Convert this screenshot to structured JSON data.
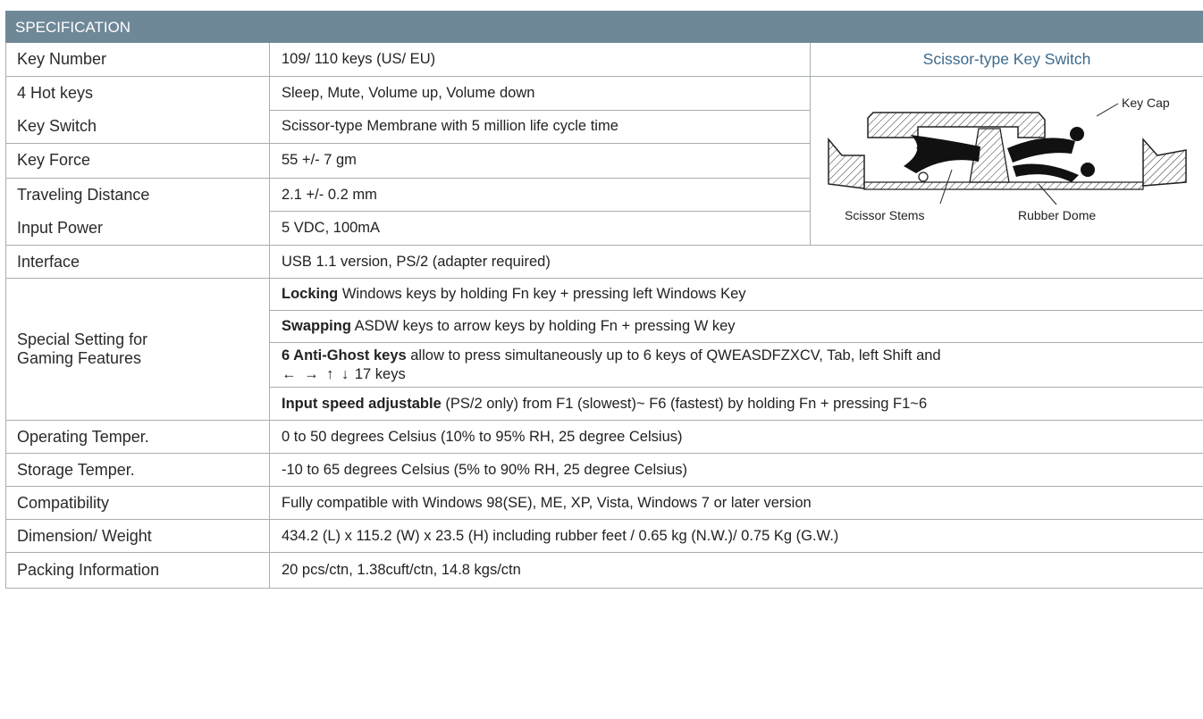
{
  "header": {
    "title": "SPECIFICATION"
  },
  "image": {
    "title": "Scissor-type Key Switch",
    "labels": {
      "key_cap": "Key Cap",
      "scissor_stems": "Scissor Stems",
      "rubber_dome": "Rubber Dome"
    }
  },
  "rows": {
    "key_number": {
      "label": "Key Number",
      "value": "109/ 110 keys (US/ EU)"
    },
    "hot_keys": {
      "label": "4 Hot keys",
      "value": "Sleep, Mute, Volume up, Volume down"
    },
    "key_switch": {
      "label": "Key Switch",
      "value": "Scissor-type Membrane with 5 million life cycle time"
    },
    "key_force": {
      "label": "Key Force",
      "value": "55 +/- 7 gm"
    },
    "traveling": {
      "label": "Traveling Distance",
      "value": "2.1 +/- 0.2 mm"
    },
    "input_power": {
      "label": "Input Power",
      "value": "5 VDC, 100mA"
    },
    "interface": {
      "label": "Interface",
      "value": "USB 1.1 version, PS/2 (adapter required)"
    },
    "special": {
      "label_line1": "Special Setting for",
      "label_line2": "Gaming Features",
      "items": [
        {
          "bold": "Locking",
          "text": " Windows keys by holding Fn key + pressing left Windows Key"
        },
        {
          "bold": "Swapping",
          "text": " ASDW keys to arrow keys by holding Fn + pressing W key"
        },
        {
          "bold": "6 Anti-Ghost keys",
          "text": " allow to press simultaneously up to 6 keys of QWEASDFZXCV, Tab, left Shift and",
          "line2_arrows": "← → ↑ ↓",
          "line2_text": " 17 keys"
        },
        {
          "bold": "Input speed adjustable",
          "text": " (PS/2 only) from F1 (slowest)~ F6 (fastest) by holding Fn + pressing F1~6"
        }
      ]
    },
    "operating": {
      "label": "Operating Temper.",
      "value": "0 to 50 degrees Celsius (10% to 95% RH, 25 degree Celsius)"
    },
    "storage": {
      "label": "Storage Temper.",
      "value": "-10 to 65 degrees Celsius (5% to 90% RH, 25 degree Celsius)"
    },
    "compat": {
      "label": "Compatibility",
      "value": "Fully compatible with Windows 98(SE), ME, XP, Vista, Windows 7 or later version"
    },
    "dimension": {
      "label": "Dimension/ Weight",
      "value": "434.2 (L) x 115.2 (W) x 23.5 (H) including rubber feet / 0.65 kg (N.W.)/ 0.75 Kg (G.W.)"
    },
    "packing": {
      "label": "Packing Information",
      "value": "20 pcs/ctn, 1.38cuft/ctn, 14.8 kgs/ctn"
    }
  }
}
